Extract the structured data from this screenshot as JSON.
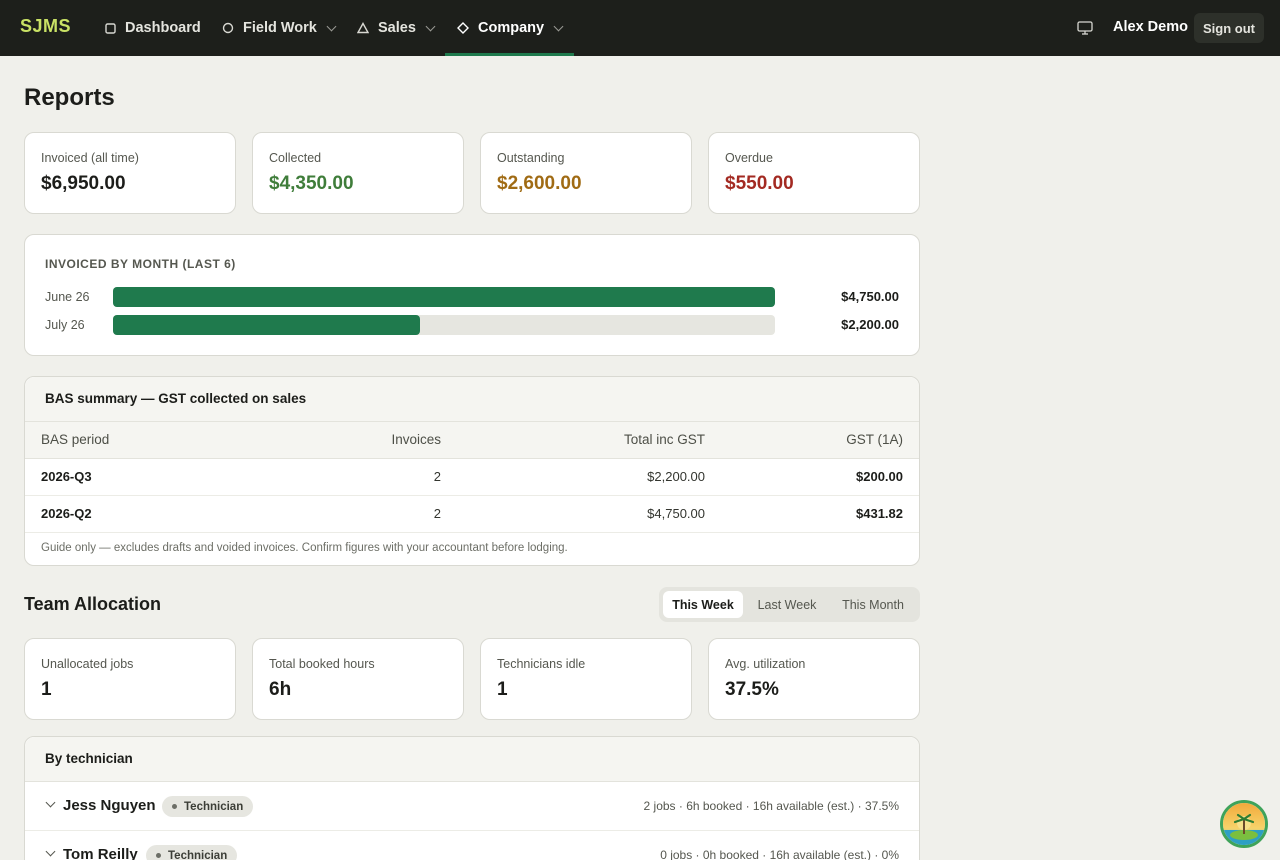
{
  "nav": {
    "brand": "SJMS",
    "items": [
      {
        "label": "Dashboard",
        "icon": "square-icon"
      },
      {
        "label": "Field Work",
        "icon": "circle-icon"
      },
      {
        "label": "Sales",
        "icon": "triangle-icon"
      },
      {
        "label": "Company",
        "icon": "diamond-icon"
      }
    ],
    "user": "Alex Demo",
    "signout": "Sign out"
  },
  "page": {
    "title": "Reports"
  },
  "finance_stats": [
    {
      "label": "Invoiced (all time)",
      "value": "$6,950.00",
      "color": "#1c1d1a"
    },
    {
      "label": "Collected",
      "value": "$4,350.00",
      "color": "#3f7d3a"
    },
    {
      "label": "Outstanding",
      "value": "$2,600.00",
      "color": "#a06b14"
    },
    {
      "label": "Overdue",
      "value": "$550.00",
      "color": "#a32a22"
    }
  ],
  "invoiced_by_month": {
    "title": "INVOICED BY MONTH (LAST 6)",
    "rows": [
      {
        "month": "June 26",
        "amount": "$4,750.00",
        "fraction": 1.0
      },
      {
        "month": "July 26",
        "amount": "$2,200.00",
        "fraction": 0.463
      }
    ]
  },
  "bas": {
    "title": "BAS summary — GST collected on sales",
    "columns": [
      "BAS period",
      "Invoices",
      "Total inc GST",
      "GST (1A)"
    ],
    "rows": [
      {
        "period": "2026-Q3",
        "invoices": "2",
        "total": "$2,200.00",
        "gst": "$200.00"
      },
      {
        "period": "2026-Q2",
        "invoices": "2",
        "total": "$4,750.00",
        "gst": "$431.82"
      }
    ],
    "note": "Guide only — excludes drafts and voided invoices. Confirm figures with your accountant before lodging."
  },
  "team": {
    "title": "Team Allocation",
    "tabs": [
      "This Week",
      "Last Week",
      "This Month"
    ],
    "active_tab": "This Week",
    "stats": [
      {
        "label": "Unallocated jobs",
        "value": "1"
      },
      {
        "label": "Total booked hours",
        "value": "6h"
      },
      {
        "label": "Technicians idle",
        "value": "1"
      },
      {
        "label": "Avg. utilization",
        "value": "37.5%"
      }
    ],
    "by_tech_title": "By technician",
    "technicians": [
      {
        "name": "Jess Nguyen",
        "role": "Technician",
        "stats": "2 jobs · 6h booked · 16h available (est.) · 37.5%"
      },
      {
        "name": "Tom Reilly",
        "role": "Technician",
        "stats": "0 jobs · 0h booked · 16h available (est.) · 0%"
      }
    ]
  }
}
